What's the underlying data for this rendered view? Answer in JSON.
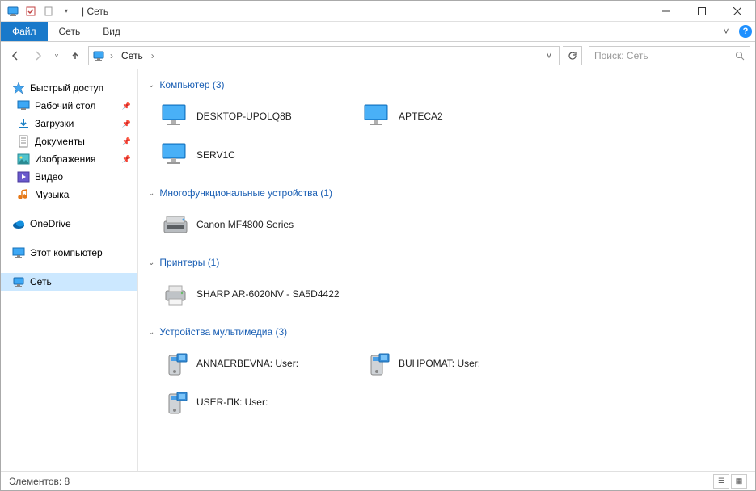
{
  "title": "Сеть",
  "ribbon": {
    "file": "Файл",
    "tabs": [
      "Сеть",
      "Вид"
    ]
  },
  "address": {
    "root": "Сеть"
  },
  "search": {
    "placeholder": "Поиск: Сеть"
  },
  "sidebar": {
    "quick_label": "Быстрый доступ",
    "quick": [
      {
        "label": "Рабочий стол",
        "icon": "desktop"
      },
      {
        "label": "Загрузки",
        "icon": "downloads"
      },
      {
        "label": "Документы",
        "icon": "documents"
      },
      {
        "label": "Изображения",
        "icon": "pictures"
      },
      {
        "label": "Видео",
        "icon": "videos"
      },
      {
        "label": "Музыка",
        "icon": "music"
      }
    ],
    "onedrive": "OneDrive",
    "thispc": "Этот компьютер",
    "network": "Сеть"
  },
  "groups": [
    {
      "title": "Компьютер",
      "count": 3,
      "type": "computer",
      "items": [
        "DESKTOP-UPOLQ8B",
        "APTECA2",
        "SERV1C"
      ]
    },
    {
      "title": "Многофункциональные устройства",
      "count": 1,
      "type": "mfd",
      "items": [
        "Canon MF4800 Series"
      ]
    },
    {
      "title": "Принтеры",
      "count": 1,
      "type": "printer",
      "items": [
        "SHARP AR-6020NV - SA5D4422"
      ]
    },
    {
      "title": "Устройства мультимедиа",
      "count": 3,
      "type": "media",
      "items": [
        "ANNAERBEVNA: User:",
        "BUHPOMAT: User:",
        "USER-ПК: User:"
      ]
    }
  ],
  "status": {
    "label": "Элементов:",
    "count": 8
  }
}
